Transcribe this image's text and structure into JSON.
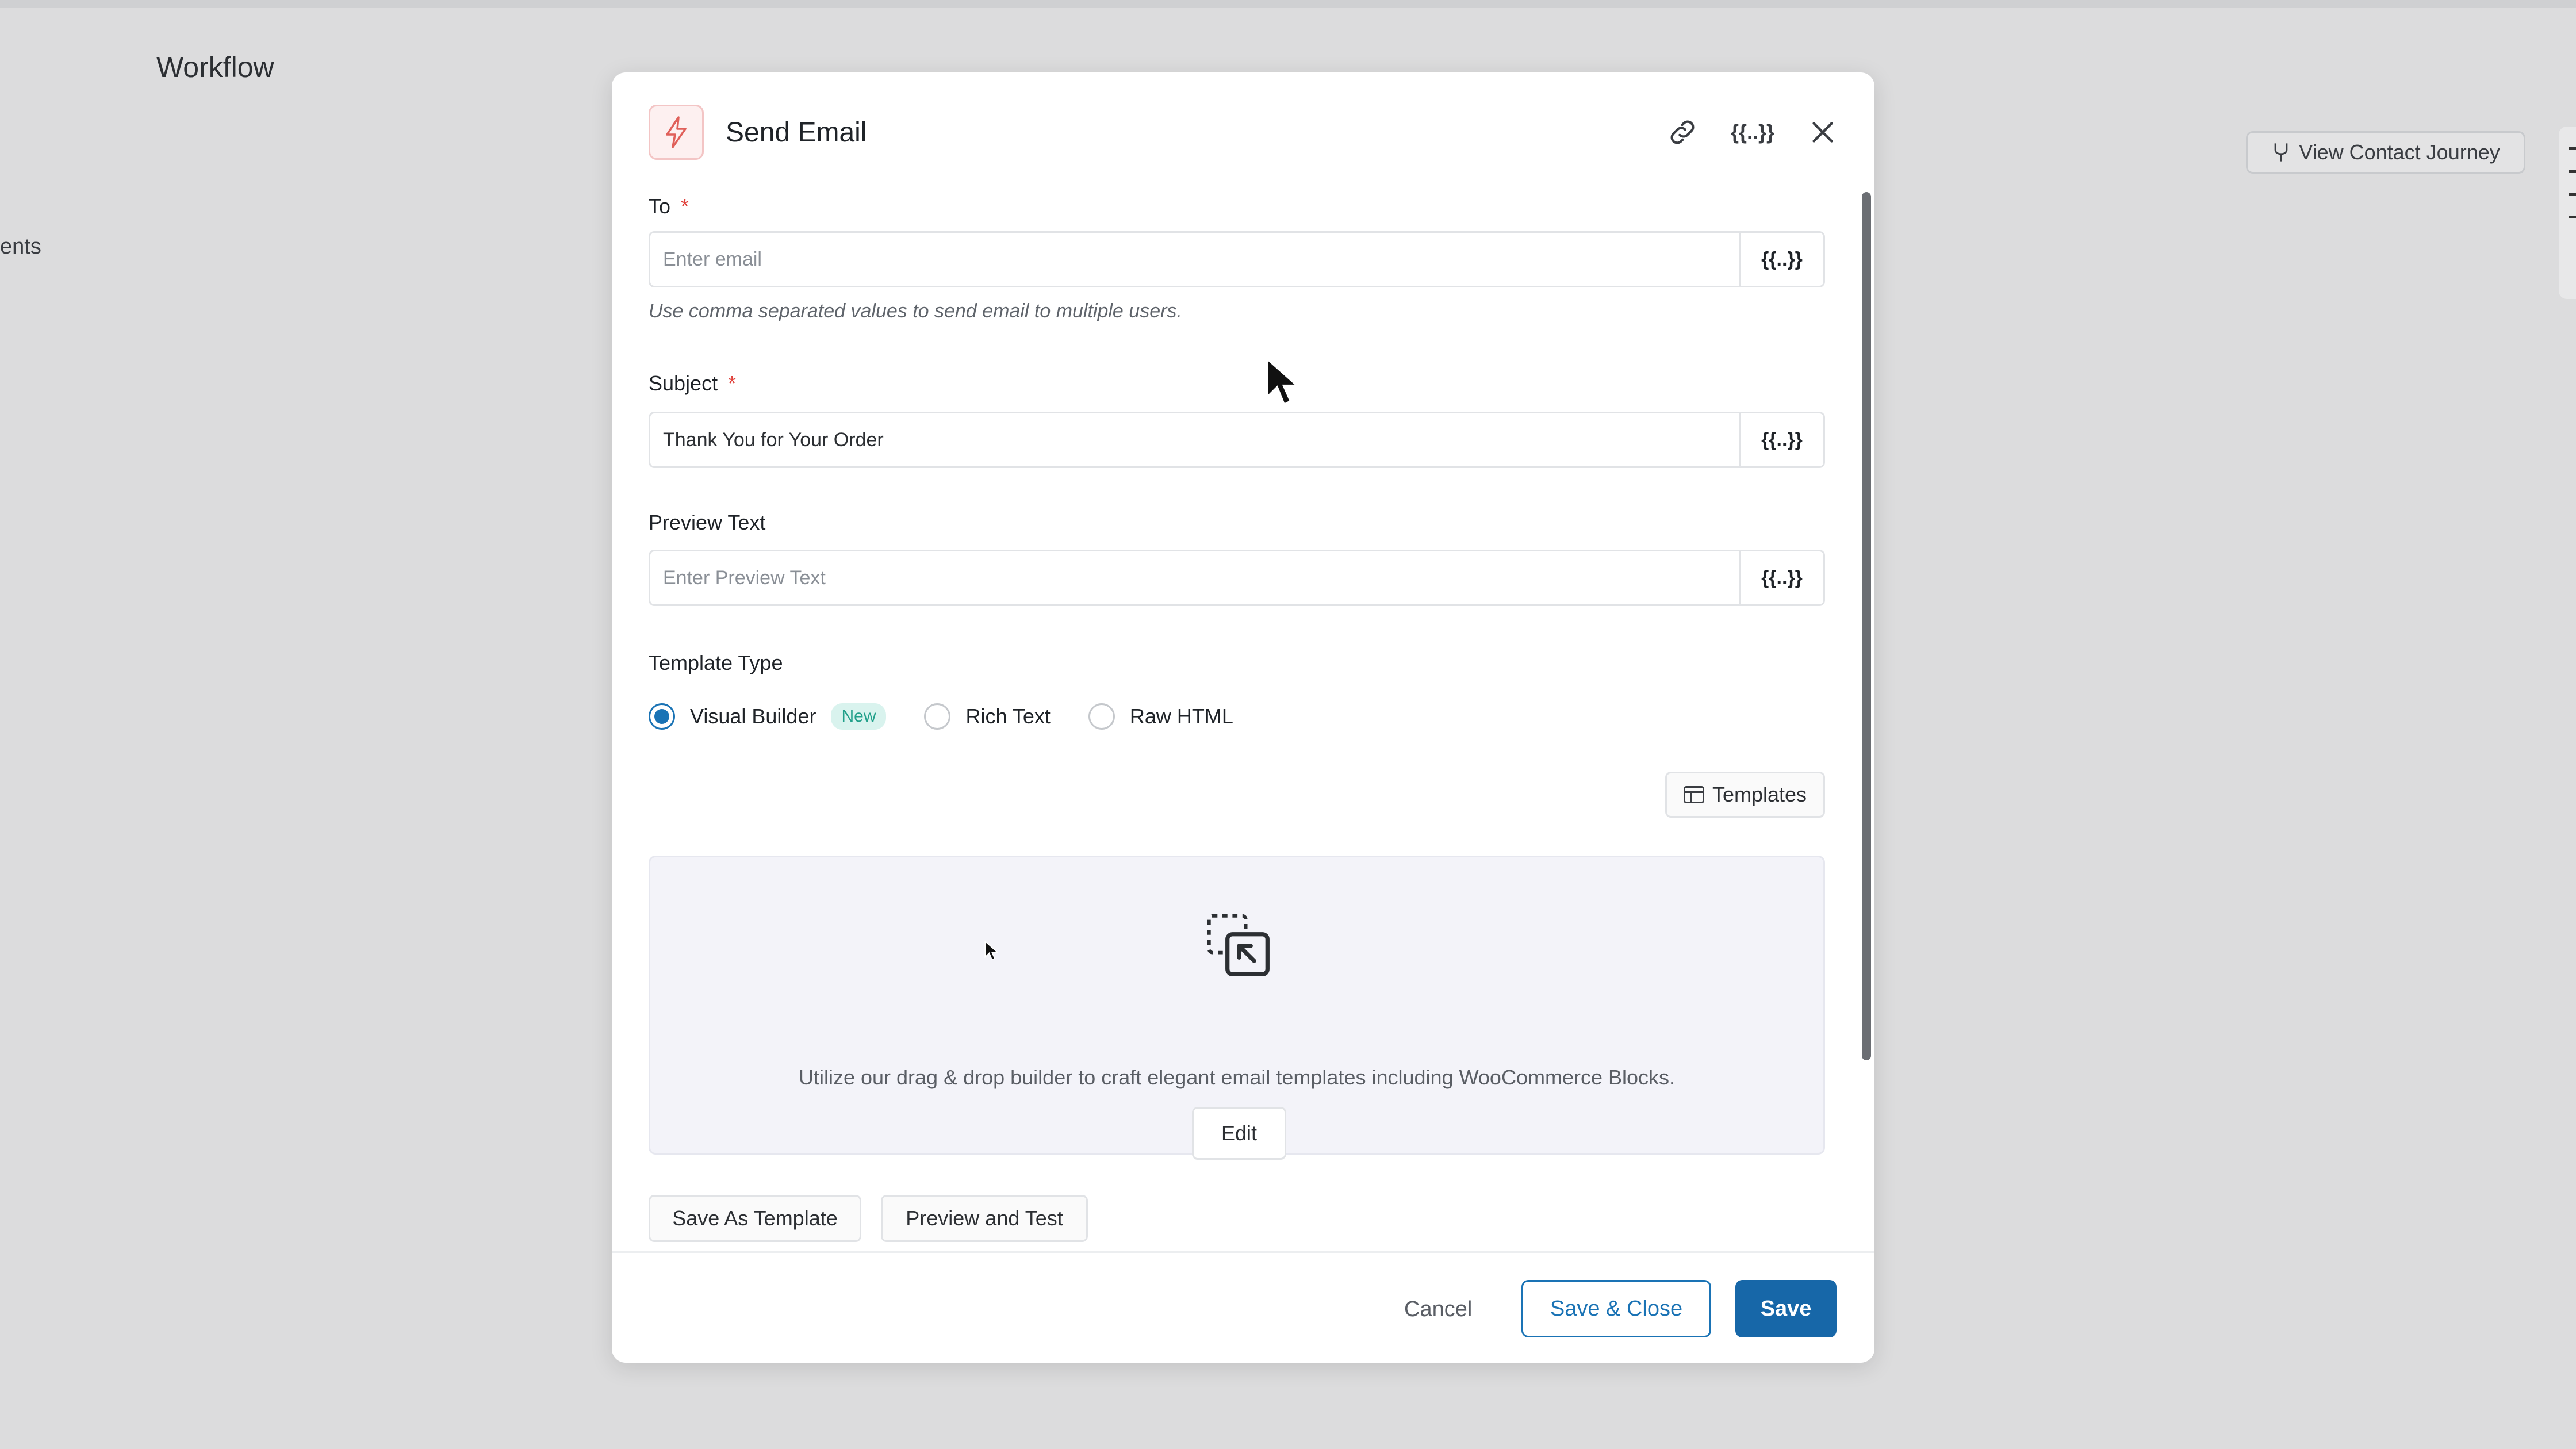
{
  "background": {
    "page_title": "Workflow",
    "side_text": "ents",
    "view_journey_label": "View Contact Journey"
  },
  "modal": {
    "title": "Send Email",
    "icons": [
      "bolt-icon",
      "link-icon",
      "merge-tag-icon",
      "close-icon"
    ],
    "merge_tag_symbol": "{{..}}",
    "to": {
      "label": "To",
      "required_mark": "*",
      "placeholder": "Enter email",
      "helper": "Use comma separated values to send email to multiple users."
    },
    "subject": {
      "label": "Subject",
      "required_mark": "*",
      "value": "Thank You for Your Order"
    },
    "preview_text": {
      "label": "Preview Text",
      "placeholder": "Enter Preview Text"
    },
    "template_type": {
      "label": "Template Type",
      "options": [
        {
          "label": "Visual Builder",
          "selected": true,
          "badge": "New"
        },
        {
          "label": "Rich Text",
          "selected": false
        },
        {
          "label": "Raw HTML",
          "selected": false
        }
      ]
    },
    "templates_button": "Templates",
    "builder": {
      "description": "Utilize our drag & drop builder to craft elegant email templates including WooCommerce Blocks.",
      "edit_label": "Edit"
    },
    "save_as_template": "Save As Template",
    "preview_and_test": "Preview and Test",
    "footer": {
      "cancel": "Cancel",
      "save_close": "Save & Close",
      "save": "Save"
    }
  },
  "colors": {
    "primary": "#1767a8",
    "accent_blue": "#1a73b5",
    "required": "#e0413b",
    "badge_bg": "#d9f3ee",
    "badge_text": "#21a08a",
    "bolt": "#e0605a"
  }
}
